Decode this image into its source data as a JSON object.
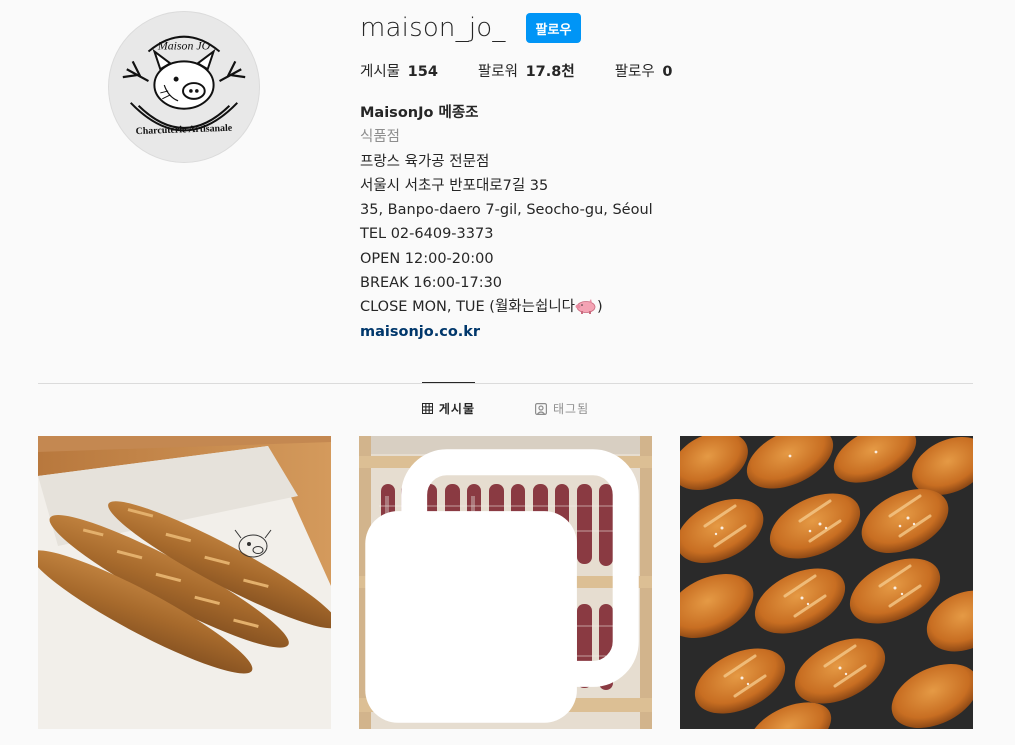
{
  "profile": {
    "username": "maison_jo_",
    "follow_label": "팔로우",
    "stats": [
      {
        "label": "게시물",
        "value": "154"
      },
      {
        "label": "팔로워",
        "value": "17.8천"
      },
      {
        "label": "팔로우",
        "value": "0"
      }
    ],
    "avatar": {
      "icon": "pig-logo",
      "logo_text_top": "Maison JO",
      "logo_text_bottom": "Charcuterie Artisanale"
    }
  },
  "bio": {
    "full_name": "MaisonJo 메종조",
    "category": "식품점",
    "lines": [
      "프랑스 육가공 전문점",
      "서울시 서초구 반포대로7길 35",
      "35, Banpo-daero 7-gil, Seocho-gu, Séoul",
      "TEL 02-6409-3373",
      "OPEN 12:00-20:00",
      "BREAK 16:00-17:30"
    ],
    "closed_line": "CLOSE MON, TUE (월화는쉽니다",
    "closed_emoji": "pig-emoji",
    "closed_suffix": ")",
    "link": "maisonjo.co.kr"
  },
  "tabs": [
    {
      "label": "게시물",
      "icon": "grid-icon",
      "active": true
    },
    {
      "label": "태그됨",
      "icon": "tagged-icon",
      "active": false
    }
  ],
  "posts": [
    {
      "subject": "baguettes",
      "icon": "none"
    },
    {
      "subject": "saucisson drying rack",
      "icon": "multi-image-icon"
    },
    {
      "subject": "salted bread rolls",
      "icon": "none"
    }
  ],
  "colors": {
    "accent": "#0095f6",
    "link": "#00376b",
    "muted": "#8e8e8e",
    "background": "#fafafa"
  }
}
